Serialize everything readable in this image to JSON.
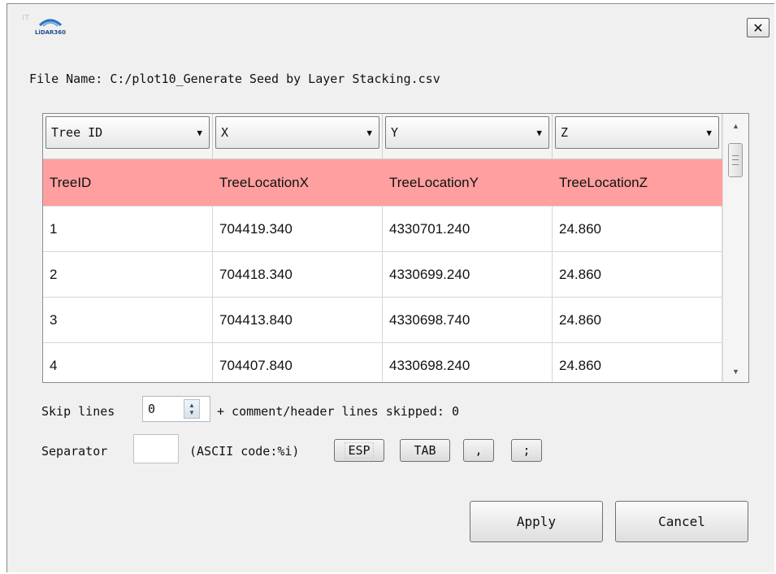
{
  "window": {
    "logo_text": "LiDAR360",
    "ghost_text": "IT",
    "close_icon": "close-icon"
  },
  "file": {
    "label": "File Name: C:/plot10_Generate Seed by Layer Stacking.csv"
  },
  "table": {
    "column_selectors": [
      "Tree ID",
      "X",
      "Y",
      "Z"
    ],
    "header_row": [
      "TreeID",
      "TreeLocationX",
      "TreeLocationY",
      "TreeLocationZ"
    ],
    "rows": [
      [
        "1",
        "704419.340",
        "4330701.240",
        "24.860"
      ],
      [
        "2",
        "704418.340",
        "4330699.240",
        "24.860"
      ],
      [
        "3",
        "704413.840",
        "4330698.740",
        "24.860"
      ],
      [
        "4",
        "704407.840",
        "4330698.240",
        "24.860"
      ]
    ],
    "header_color": "#ff9f9f"
  },
  "skip": {
    "label": "Skip lines",
    "value": "0",
    "skipped_label": "+ comment/header lines skipped: 0"
  },
  "separator": {
    "label": "Separator",
    "value": "",
    "ascii_label": "(ASCII code:%i)",
    "buttons": [
      "ESP",
      "TAB",
      ",",
      ";"
    ]
  },
  "actions": {
    "apply": "Apply",
    "cancel": "Cancel"
  }
}
